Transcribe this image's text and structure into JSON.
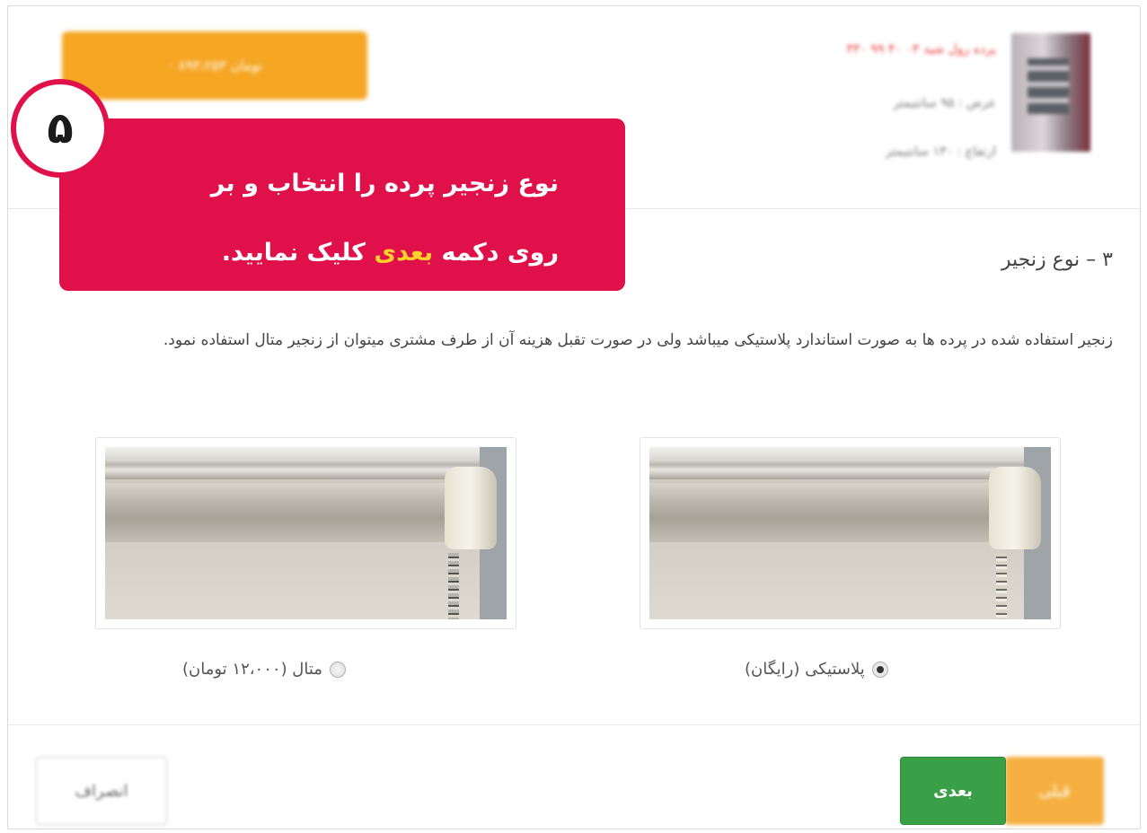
{
  "header": {
    "price_button_label": "۰ ۸۹۳،۲۵۳ تومان",
    "product_title": "پرده رول شید ۰۳ ۴۰ ۹۹ ۳۳۰",
    "product_width": "عرض : ۹۵ سانتیمتر",
    "product_height": "ارتفاع : ۱۳۰ سانتیمتر"
  },
  "callout": {
    "badge": "۵",
    "line1": "نوع زنجیر پرده را انتخاب و بر",
    "line2_before": "روی دکمه ",
    "line2_highlight": "بعدی",
    "line2_after": " کلیک نمایید."
  },
  "step": {
    "title": "۳ – نوع زنجیر",
    "description": "زنجیر استفاده شده در پرده ها به صورت استاندارد پلاستیکی میباشد ولی در صورت تقبل هزینه آن از طرف مشتری میتوان از زنجیر متال استفاده نمود."
  },
  "options": [
    {
      "label": "پلاستیکی (رایگان)",
      "selected": true
    },
    {
      "label": "متال (۱۲،۰۰۰ تومان)",
      "selected": false
    }
  ],
  "footer": {
    "prev_label": "قبلی",
    "next_label": "بعدی",
    "cancel_label": "انصراف"
  },
  "colors": {
    "callout_bg": "#e0104a",
    "highlight": "#ffd12a",
    "next_button": "#3aa047",
    "prev_button": "#f5b041",
    "price_button": "#f5a623"
  }
}
